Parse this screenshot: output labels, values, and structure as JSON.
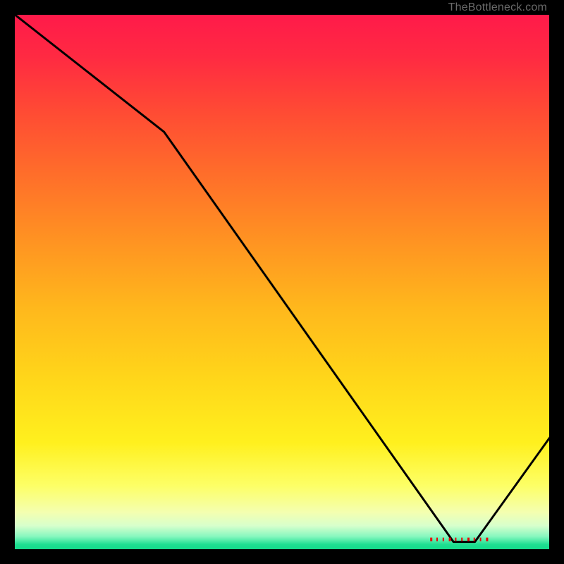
{
  "watermark": "TheBottleneck.com",
  "bottom_label": "",
  "line_color": "#000000",
  "gradient_stops": [
    {
      "offset": 0.0,
      "color": "#ff1a4a"
    },
    {
      "offset": 0.08,
      "color": "#ff2a42"
    },
    {
      "offset": 0.18,
      "color": "#ff4a34"
    },
    {
      "offset": 0.3,
      "color": "#ff6e2a"
    },
    {
      "offset": 0.42,
      "color": "#ff9222"
    },
    {
      "offset": 0.55,
      "color": "#ffb81c"
    },
    {
      "offset": 0.68,
      "color": "#ffd61a"
    },
    {
      "offset": 0.8,
      "color": "#fff01e"
    },
    {
      "offset": 0.88,
      "color": "#fdff66"
    },
    {
      "offset": 0.93,
      "color": "#f4ffb0"
    },
    {
      "offset": 0.955,
      "color": "#d7ffcc"
    },
    {
      "offset": 0.975,
      "color": "#86f7bf"
    },
    {
      "offset": 0.99,
      "color": "#1edf91"
    },
    {
      "offset": 1.0,
      "color": "#14d989"
    }
  ],
  "chart_data": {
    "type": "line",
    "title": "",
    "xlabel": "",
    "ylabel": "",
    "xlim": [
      0,
      100
    ],
    "ylim": [
      0,
      100
    ],
    "x": [
      0,
      28,
      82,
      86,
      100
    ],
    "values": [
      100,
      78,
      1.5,
      1.5,
      21
    ],
    "minimum_segment": {
      "x_start": 77,
      "x_end": 89,
      "y": 1.5
    }
  }
}
